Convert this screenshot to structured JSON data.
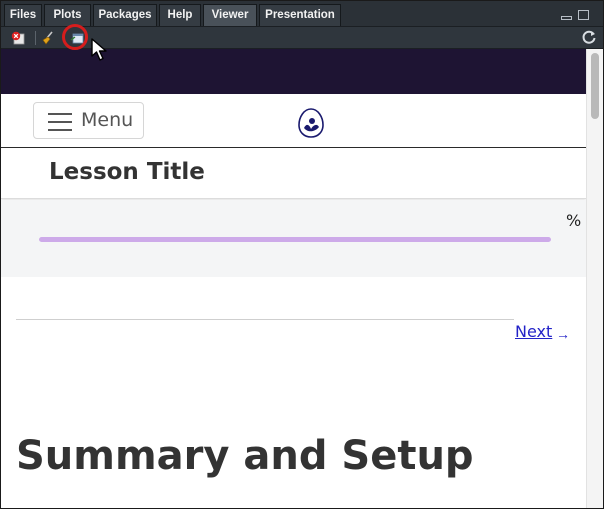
{
  "pane": {
    "tabs": [
      {
        "label": "Files",
        "active": false
      },
      {
        "label": "Plots",
        "active": false
      },
      {
        "label": "Packages",
        "active": false
      },
      {
        "label": "Help",
        "active": false
      },
      {
        "label": "Viewer",
        "active": true
      },
      {
        "label": "Presentation",
        "active": false
      }
    ]
  },
  "toolbar": {
    "icons": [
      "remove-viewer-icon",
      "clear-all-icon",
      "show-in-new-window-icon",
      "refresh-icon"
    ]
  },
  "page": {
    "menu_label": "Menu",
    "lesson_title": "Lesson Title",
    "progress_unit": "%",
    "progress_fraction": 1.0,
    "next_label": "Next",
    "next_arrow": "→",
    "heading": "Summary and Setup"
  },
  "colors": {
    "topbar": "#1e1433",
    "progress_fill": "#cdaae9",
    "link": "#2323c8",
    "highlight_ring": "#d61d1d"
  }
}
